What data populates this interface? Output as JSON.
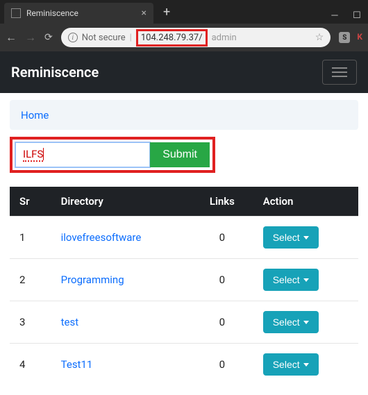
{
  "browser": {
    "tab_title": "Reminiscence",
    "url_secure_label": "Not secure",
    "url_host": "104.248.79.37/",
    "url_path": "admin",
    "ext_s": "S",
    "ext_k": "K"
  },
  "navbar": {
    "brand": "Reminiscence"
  },
  "breadcrumb": {
    "home": "Home"
  },
  "form": {
    "input_value": "ILFS",
    "submit_label": "Submit"
  },
  "table": {
    "headers": {
      "sr": "Sr",
      "directory": "Directory",
      "links": "Links",
      "action": "Action"
    },
    "select_label": "Select",
    "rows": [
      {
        "sr": "1",
        "dir": "ilovefreesoftware",
        "links": "0"
      },
      {
        "sr": "2",
        "dir": "Programming",
        "links": "0"
      },
      {
        "sr": "3",
        "dir": "test",
        "links": "0"
      },
      {
        "sr": "4",
        "dir": "Test11",
        "links": "0"
      }
    ]
  }
}
